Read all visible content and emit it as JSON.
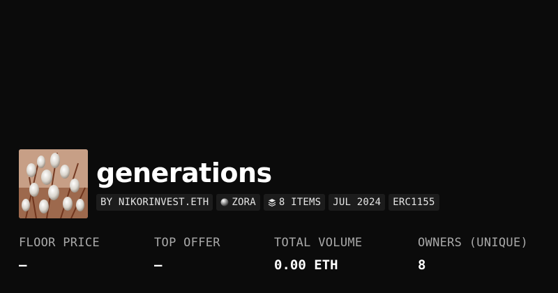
{
  "collection": {
    "title": "generations",
    "thumbnail_icon": "pussy-willow-photo"
  },
  "tags": {
    "creator": "BY NIKORINVEST.ETH",
    "chain": "ZORA",
    "chain_icon": "zora-orb-icon",
    "items": "8 ITEMS",
    "items_icon": "layers-icon",
    "date": "JUL 2024",
    "standard": "ERC1155"
  },
  "stats": {
    "floor_price": {
      "label": "FLOOR PRICE",
      "value": "—"
    },
    "top_offer": {
      "label": "TOP OFFER",
      "value": "—"
    },
    "total_volume": {
      "label": "TOTAL VOLUME",
      "value": "0.00 ETH"
    },
    "owners": {
      "label": "OWNERS (UNIQUE)",
      "value": "8"
    }
  },
  "colors": {
    "background": "#0b0b0b",
    "tag_background": "#1c1c1c",
    "label_gray": "#a9a9a9",
    "text": "#ffffff"
  }
}
